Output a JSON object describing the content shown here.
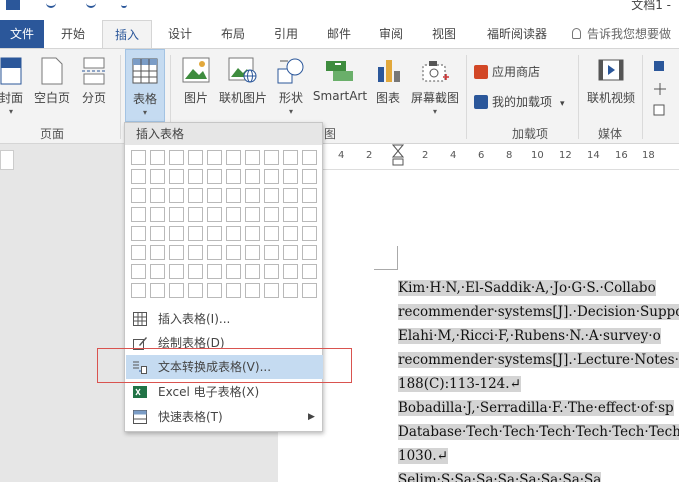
{
  "window": {
    "title_fragment": "文档1 -"
  },
  "tabs": [
    {
      "label": "文件",
      "id": "file"
    },
    {
      "label": "开始",
      "id": "home"
    },
    {
      "label": "插入",
      "id": "insert",
      "active": true
    },
    {
      "label": "设计",
      "id": "design"
    },
    {
      "label": "布局",
      "id": "layout"
    },
    {
      "label": "引用",
      "id": "references"
    },
    {
      "label": "邮件",
      "id": "mailings"
    },
    {
      "label": "审阅",
      "id": "review"
    },
    {
      "label": "视图",
      "id": "view"
    },
    {
      "label": "福昕阅读器",
      "id": "foxit"
    }
  ],
  "tellme": {
    "placeholder": "告诉我您想要做"
  },
  "ribbon": {
    "pages_group": {
      "label": "页面",
      "buttons": [
        "封面",
        "空白页",
        "分页"
      ]
    },
    "table_button": {
      "label": "表格"
    },
    "illustrations_group": {
      "label_fragment": "图",
      "buttons": [
        "图片",
        "联机图片",
        "形状",
        "SmartArt",
        "图表",
        "屏幕截图"
      ]
    },
    "addins_group": {
      "label": "加载项",
      "store": "应用商店",
      "my_addins": "我的加载项"
    },
    "media_group": {
      "label": "媒体",
      "online_video": "联机视频"
    }
  },
  "ruler": {
    "ticks": [
      "4",
      "2",
      "2",
      "4",
      "6",
      "8",
      "10",
      "12",
      "14",
      "16",
      "18"
    ]
  },
  "table_menu": {
    "header": "插入表格",
    "grid": {
      "rows": 8,
      "cols": 10
    },
    "items": [
      {
        "label": "插入表格(I)...",
        "icon": "table-icon"
      },
      {
        "label": "绘制表格(D)",
        "icon": "pencil-table-icon"
      },
      {
        "label": "文本转换成表格(V)...",
        "icon": "text-to-table-icon",
        "highlighted": true
      },
      {
        "label": "Excel 电子表格(X)",
        "icon": "excel-icon"
      },
      {
        "label": "快速表格(T)",
        "icon": "quick-table-icon",
        "submenu": true
      }
    ]
  },
  "document": {
    "lines": [
      "Kim·H·N,·El-Saddik·A,·Jo·G·S.·Collabo",
      "recommender·systems[J].·Decision·Suppor",
      "Elahi·M,·Ricci·F,·Rubens·N.·A·survey·o",
      "recommender·systems[J].·Lecture·Notes·",
      "188(C):113-124.↵",
      "Bobadilla·J,·Serradilla·F.·The·effect·of·sp",
      "Database·Tech·Tech·Tech·Tech·Tech·Tech·T",
      "1030.↵",
      "Selim·S·Sa·Sa·Sa·Sa·Sa·Sa·Sa"
    ]
  }
}
